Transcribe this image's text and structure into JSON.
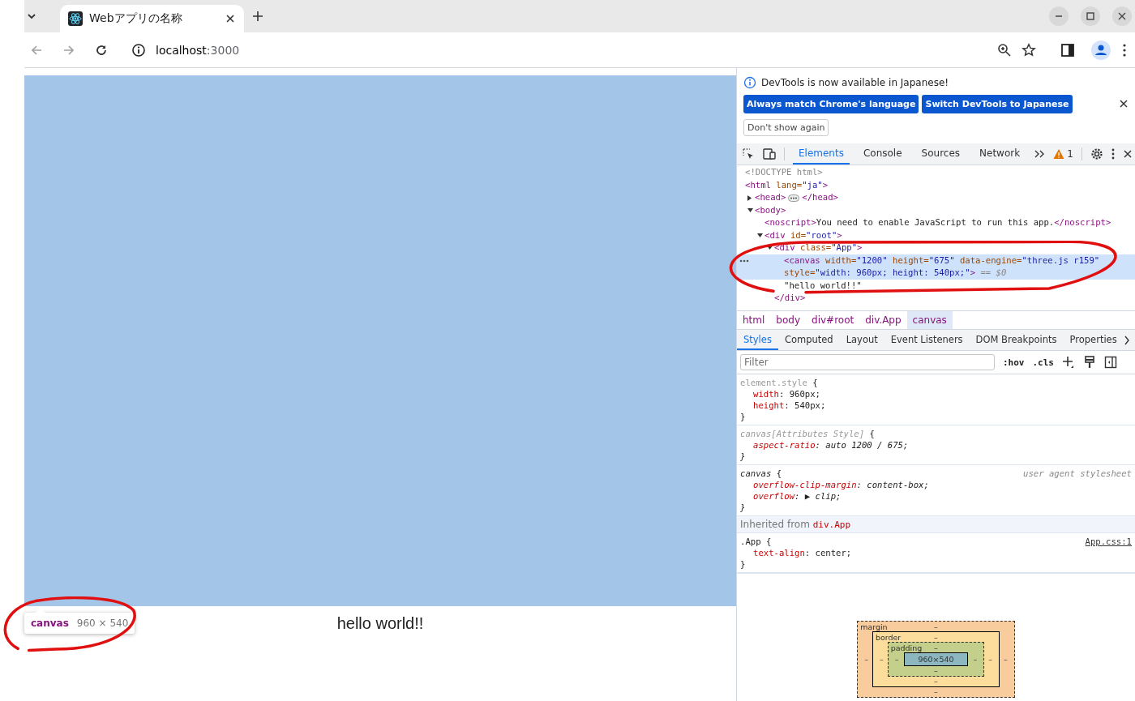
{
  "browser": {
    "tab": {
      "title": "Webアプリの名称",
      "selected": true
    },
    "nav_buttons": [
      {
        "kind": "back",
        "disabled": true
      },
      {
        "kind": "forward",
        "disabled": true
      },
      {
        "kind": "reload",
        "disabled": false
      }
    ],
    "address": {
      "host": "localhost",
      "port": ":3000"
    }
  },
  "page": {
    "text": "hello world!!",
    "tooltip": {
      "tag": "canvas",
      "size": "960 × 540"
    }
  },
  "devtools": {
    "infobar": {
      "message": "DevTools is now available in Japanese!",
      "buttons": [
        "Always match Chrome's language",
        "Switch DevTools to Japanese"
      ],
      "dismiss": "Don't show again"
    },
    "tabs": [
      {
        "label": "Elements",
        "selected": true
      },
      {
        "label": "Console",
        "selected": false
      },
      {
        "label": "Sources",
        "selected": false
      },
      {
        "label": "Network",
        "selected": false
      }
    ],
    "warnings": "1",
    "dom_tree": [
      {
        "text": "<!DOCTYPE html>",
        "kind": "doctype",
        "selected": false
      },
      {
        "text": "<html lang=\"ja\">",
        "kind": "element",
        "selected": false,
        "children": [
          {
            "text": "<head>",
            "kind": "element",
            "selected": false,
            "expanded": false,
            "close": "</head>"
          },
          {
            "text": "<body>",
            "kind": "element",
            "selected": false,
            "expanded": true,
            "children": [
              {
                "text": "<noscript>You need to enable JavaScript to run this app.</noscript>",
                "kind": "element",
                "selected": false
              },
              {
                "text": "<div id=\"root\">",
                "kind": "element",
                "selected": false,
                "expanded": true,
                "children": [
                  {
                    "text": "<div class=\"App\">",
                    "kind": "element",
                    "selected": false,
                    "expanded": true,
                    "children": [
                      {
                        "text": "<canvas width=\"1200\" height=\"675\" data-engine=\"three.js r159\" style=\"width: 960px; height: 540px;\">",
                        "kind": "element",
                        "selected": true,
                        "suffix": "== $0"
                      },
                      {
                        "text": "\"hello world!!\"",
                        "kind": "text",
                        "selected": false
                      }
                    ],
                    "close": "</div>"
                  }
                ]
              }
            ]
          }
        ]
      }
    ],
    "breadcrumbs": [
      {
        "label": "html",
        "selected": false
      },
      {
        "label": "body",
        "selected": false
      },
      {
        "label": "div#root",
        "selected": false
      },
      {
        "label": "div.App",
        "selected": false
      },
      {
        "label": "canvas",
        "selected": true
      }
    ],
    "subtabs": [
      {
        "label": "Styles",
        "selected": true
      },
      {
        "label": "Computed",
        "selected": false
      },
      {
        "label": "Layout",
        "selected": false
      },
      {
        "label": "Event Listeners",
        "selected": false
      },
      {
        "label": "DOM Breakpoints",
        "selected": false
      },
      {
        "label": "Properties",
        "selected": false
      }
    ],
    "filter": {
      "placeholder": "Filter",
      "tools": [
        ":hov",
        ".cls"
      ]
    },
    "rules": [
      {
        "kind": "inline",
        "selector": "element.style",
        "open": "{",
        "lines": [
          "width: 960px;",
          "height: 540px;"
        ],
        "end": "}"
      },
      {
        "kind": "attributes",
        "selector": "canvas[Attributes Style]",
        "open": "{",
        "lines": [
          "aspect-ratio: auto 1200 / 675;"
        ],
        "end": "}"
      },
      {
        "kind": "user-agent",
        "selector": "canvas",
        "open": "{",
        "source": "user agent stylesheet",
        "lines": [
          "overflow-clip-margin: content-box;",
          "overflow: ▶ clip;"
        ],
        "end": "}"
      }
    ],
    "inherited": {
      "label": "Inherited from",
      "element": "div.App",
      "rules": [
        {
          "kind": "author",
          "selector": ".App",
          "open": "{",
          "source": "App.css:1",
          "lines": [
            "text-align: center;"
          ],
          "end": "}"
        }
      ]
    },
    "box_model": {
      "layers": [
        {
          "label": "margin",
          "top": "–",
          "left": "–"
        },
        {
          "label": "border",
          "top": "–",
          "left": "–"
        },
        {
          "label": "padding",
          "top": "–",
          "left": "–"
        }
      ],
      "content": "960×540",
      "outer_sides": [
        {
          "right": "–",
          "bottom": "–"
        },
        {
          "right": "–",
          "bottom": "–"
        },
        {
          "right": "–",
          "bottom": "–"
        }
      ]
    }
  }
}
